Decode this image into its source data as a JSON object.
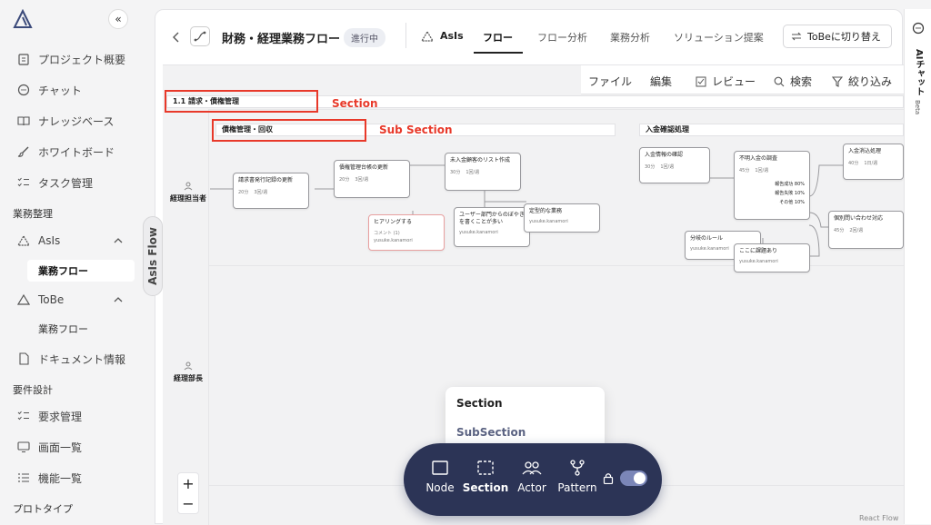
{
  "sidebar": {
    "collapse_label": "«",
    "items": [
      {
        "label": "プロジェクト概要",
        "icon": "clipboard-icon"
      },
      {
        "label": "チャット",
        "icon": "chat-bubble-icon"
      },
      {
        "label": "ナレッジベース",
        "icon": "book-icon"
      },
      {
        "label": "ホワイトボード",
        "icon": "brush-icon"
      },
      {
        "label": "タスク管理",
        "icon": "task-list-icon"
      }
    ],
    "group_business": "業務整理",
    "asis": {
      "label": "AsIs",
      "sub": "業務フロー"
    },
    "tobe": {
      "label": "ToBe",
      "sub": "業務フロー"
    },
    "doc_info": "ドキュメント情報",
    "group_requirements": "要件設計",
    "req_items": [
      {
        "label": "要求管理",
        "icon": "task-list-icon"
      },
      {
        "label": "画面一覧",
        "icon": "monitor-icon"
      },
      {
        "label": "機能一覧",
        "icon": "list-icon"
      }
    ],
    "group_proto": "プロトタイプ",
    "handle_label": "AsIs Flow"
  },
  "header": {
    "title": "財務・経理業務フロー",
    "status": "進行中",
    "asis_label": "AsIs",
    "tabs": [
      "フロー",
      "フロー分析",
      "業務分析",
      "ソリューション提案"
    ],
    "switch_button": "ToBeに切り替え"
  },
  "canvas_toolbar": {
    "file": "ファイル",
    "edit": "編集",
    "review": "レビュー",
    "search": "検索",
    "filter": "絞り込み"
  },
  "flow": {
    "section_bar": "1.1 請求・債権管理",
    "subsection_bar": "債権管理・回収",
    "subsection2_bar": "入金確認処理",
    "annotation_section": "Section",
    "annotation_subsection": "Sub Section",
    "actors": [
      "経理担当者",
      "経理部長"
    ],
    "nodes": [
      {
        "title": "請求書発行記録の更新",
        "meta": [
          "20分",
          "3回/週"
        ]
      },
      {
        "title": "債権管理台帳の更新",
        "meta": [
          "20分",
          "3回/週"
        ]
      },
      {
        "title": "未入金顧客のリスト作成",
        "meta": [
          "30分",
          "1回/週"
        ]
      },
      {
        "title": "ヒアリングする",
        "meta": [
          "コメント (1)",
          "yusuke.kanamori"
        ]
      },
      {
        "title": "ユーザー部門からのぼやきを書くことが多い",
        "meta": [
          "yusuke.kanamori"
        ]
      },
      {
        "title": "定型的な業務",
        "meta": [
          "yusuke.kanamori"
        ]
      },
      {
        "title": "入金情報の確認",
        "meta": [
          "30分",
          "1回/週"
        ]
      },
      {
        "title": "不明入金の調査",
        "meta": [
          "45分",
          "1回/週"
        ]
      },
      {
        "title": "入金消込処理",
        "meta": [
          "40分",
          "1日/週"
        ]
      },
      {
        "title": "個別問い合わせ対応",
        "meta": [
          "45分",
          "2回/週"
        ]
      },
      {
        "title": "分岐のルール",
        "meta": [
          "yusuke.kanamori"
        ]
      },
      {
        "title": "ここに課題あり",
        "meta": [
          "yusuke.kanamori"
        ]
      }
    ],
    "branch_labels": [
      "報告成功 80%",
      "報告失敗 10%",
      "その他 10%"
    ]
  },
  "popup": {
    "item1": "Section",
    "item2": "SubSection"
  },
  "dock": {
    "node": "Node",
    "section": "Section",
    "actor": "Actor",
    "pattern": "Pattern"
  },
  "zoom": {
    "in": "+",
    "out": "−"
  },
  "rail": {
    "label": "AIチャット",
    "beta": "Beta"
  },
  "footer": {
    "attribution": "React Flow"
  },
  "colors": {
    "accent_red": "#e8392a",
    "dock_bg": "#2c3456",
    "toggle": "#7b86b8"
  }
}
